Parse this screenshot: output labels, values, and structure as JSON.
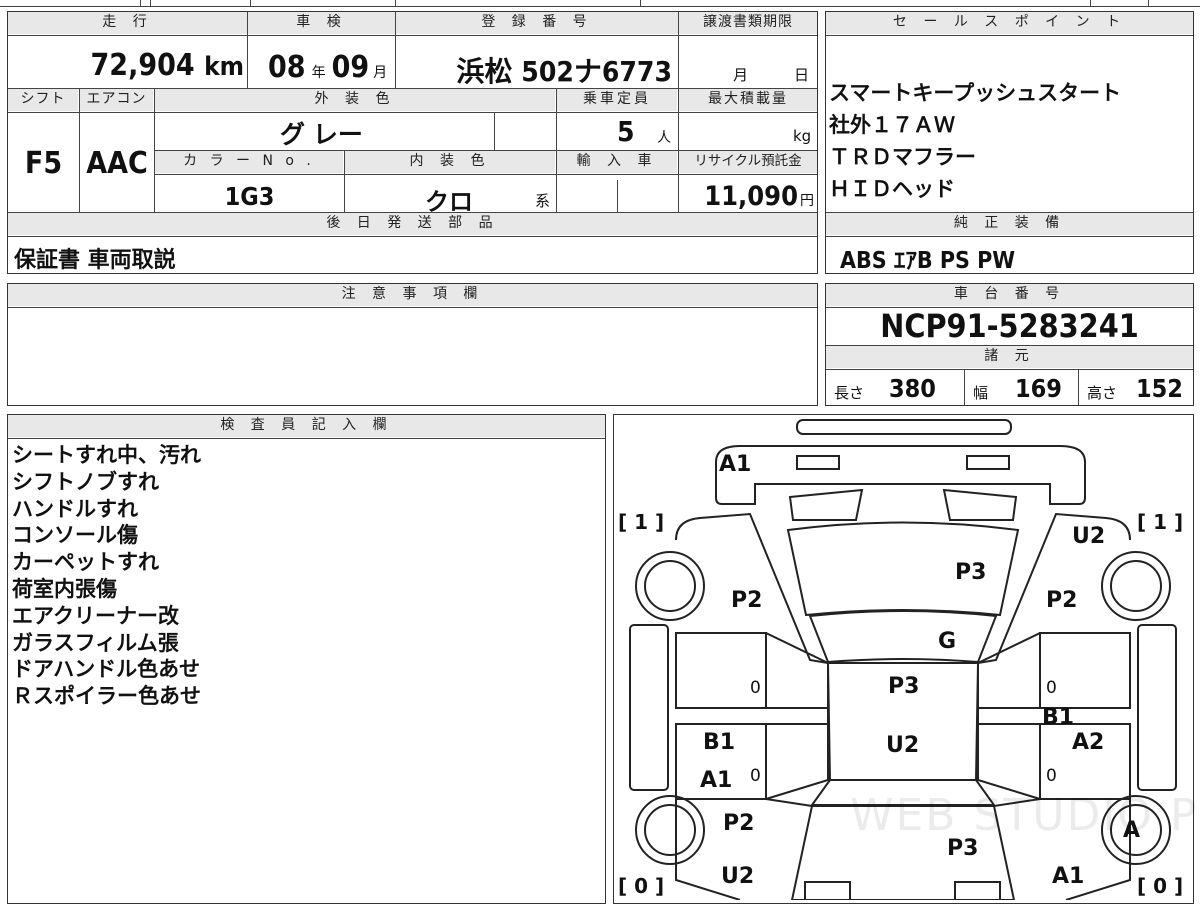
{
  "main": {
    "h_mileage": "走 行",
    "mileage_num": "72,904",
    "mileage_unit": "km",
    "h_inspection": "車 検",
    "insp_year": "08",
    "insp_year_unit": "年",
    "insp_month": "09",
    "insp_month_unit": "月",
    "h_reg": "登 録 番 号",
    "reg_value": "浜松 502ナ6773",
    "h_transfer": "譲渡書類期限",
    "transfer_month": "月",
    "transfer_day": "日",
    "h_shift": "シフト",
    "shift": "F5",
    "h_ac": "エアコン",
    "ac": "AAC",
    "h_ext_color": "外 装 色",
    "ext_color": "グ レー",
    "h_capacity": "乗車定員",
    "capacity": "5",
    "capacity_unit": "人",
    "h_maxload": "最大積載量",
    "maxload_unit": "kg",
    "h_color_no": "カ ラ ー N o .",
    "color_no": "1G3",
    "h_int_color": "内 装 色",
    "int_color": "クロ",
    "int_color_suffix": "系",
    "h_import": "輸 入 車",
    "h_recycle": "リサイクル預託金",
    "recycle_num": "11,090",
    "recycle_unit": "円",
    "h_later": "後 日 発 送 部 品",
    "later_items": "保証書 車両取説",
    "h_caution": "注 意 事 項 欄"
  },
  "sales": {
    "h_sales": "セ ー ル ス ポ イ ン ト",
    "items": [
      "スマートキープッシュスタート",
      "社外１７ＡＷ",
      "ＴＲＤマフラー",
      "ＨＩＤヘッド"
    ],
    "h_equip": "純 正 装 備",
    "equipment": "ABS ｴｱB PS PW"
  },
  "chassis": {
    "h_chassis": "車 台 番 号",
    "chassis_no": "NCP91-5283241",
    "h_specs": "諸 元",
    "len_label": "長さ",
    "len": "380",
    "wid_label": "幅",
    "wid": "169",
    "hgt_label": "高さ",
    "hgt": "152"
  },
  "inspector": {
    "h_inspector": "検 査 員 記 入 欄",
    "notes": [
      "シートすれ中、汚れ",
      "シフトノブすれ",
      "ハンドルすれ",
      "コンソール傷",
      "カーペットすれ",
      "荷室内張傷",
      "エアクリーナー改",
      "ガラスフィルム張",
      "ドアハンドル色あせ",
      "Ｒスポイラー色あせ"
    ]
  },
  "diagram": {
    "tire_tl": "[ 1 ]",
    "tire_tr": "[ 1 ]",
    "tire_bl": "[ 0 ]",
    "tire_br": "[ 0 ]",
    "marks": [
      "A1",
      "U2",
      "P3",
      "P2",
      "P2",
      "G",
      "P3",
      "0",
      "0",
      "B1",
      "B1",
      "U2",
      "A2",
      "A1",
      "0",
      "0",
      "P2",
      "A",
      "P3",
      "U2",
      "A1"
    ],
    "watermark": "WEB STUDIO P"
  }
}
